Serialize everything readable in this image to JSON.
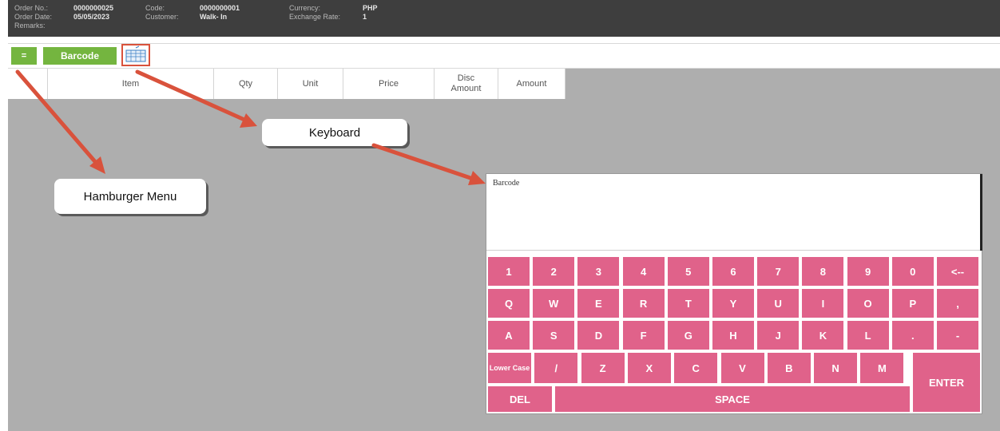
{
  "header": {
    "order_no_label": "Order No.:",
    "order_no_value": "0000000025",
    "order_date_label": "Order Date:",
    "order_date_value": "05/05/2023",
    "remarks_label": "Remarks:",
    "code_label": "Code:",
    "code_value": "0000000001",
    "customer_label": "Customer:",
    "customer_value": "Walk- In",
    "currency_label": "Currency:",
    "currency_value": "PHP",
    "exchange_rate_label": "Exchange Rate:",
    "exchange_rate_value": "1"
  },
  "toolbar": {
    "menu_label": "=",
    "barcode_label": "Barcode",
    "keyboard_icon": "keyboard-icon"
  },
  "grid": {
    "columns": [
      "",
      "Item",
      "Qty",
      "Unit",
      "Price",
      "Disc Amount",
      "Amount"
    ]
  },
  "callouts": {
    "keyboard": "Keyboard",
    "hamburger": "Hamburger Menu"
  },
  "keyboard_panel": {
    "input_label": "Barcode",
    "rows": [
      [
        "1",
        "2",
        "3",
        "4",
        "5",
        "6",
        "7",
        "8",
        "9",
        "0",
        "<--"
      ],
      [
        "Q",
        "W",
        "E",
        "R",
        "T",
        "Y",
        "U",
        "I",
        "O",
        "P",
        ","
      ],
      [
        "A",
        "S",
        "D",
        "F",
        "G",
        "H",
        "J",
        "K",
        "L",
        ".",
        "-"
      ],
      [
        "Lower Case",
        "/",
        "Z",
        "X",
        "C",
        "V",
        "B",
        "N",
        "M"
      ]
    ],
    "del_label": "DEL",
    "space_label": "SPACE",
    "enter_label": "ENTER"
  },
  "colors": {
    "accent_green": "#74b53f",
    "key_pink": "#e0628a",
    "annotation_red": "#d9523c",
    "header_bg": "#3e3e3e"
  }
}
